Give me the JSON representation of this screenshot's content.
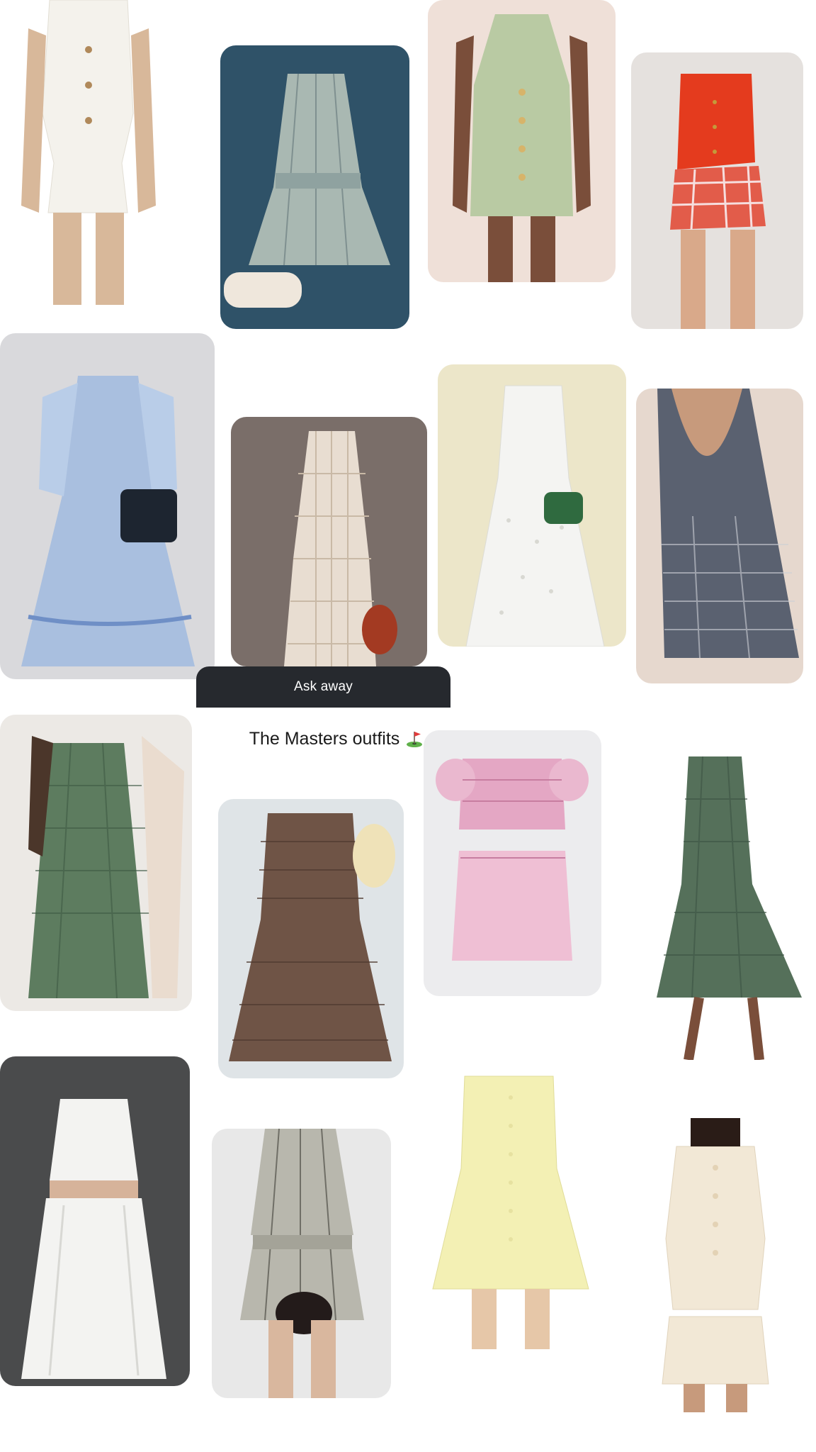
{
  "assistant": {
    "prompt_label": "Ask away"
  },
  "board": {
    "title": "The Masters outfits",
    "title_icon": "golf-flag-icon"
  },
  "pins": [
    {
      "id": "white-vest-mini-dress",
      "kind": "cutout",
      "bg": "#ffffff",
      "garment": "#f4f2ec"
    },
    {
      "id": "striped-shirt-dress",
      "kind": "photo",
      "bg": "#2f5268",
      "garment": "#a9b8b2"
    },
    {
      "id": "sage-halter-button-dress",
      "kind": "photo",
      "bg": "#efe0d8",
      "garment": "#b9caa3"
    },
    {
      "id": "red-vest-gingham-shorts",
      "kind": "photo",
      "bg": "#e5e1de",
      "garment": "#e43b1e"
    },
    {
      "id": "blue-embroidered-midi-dress",
      "kind": "photo",
      "bg": "#d9d9dc",
      "garment": "#a9bfdf"
    },
    {
      "id": "crochet-lace-midi-dress",
      "kind": "photo",
      "bg": "#7a6e69",
      "garment": "#e8ddd1"
    },
    {
      "id": "white-eyelet-strap-dress",
      "kind": "photo",
      "bg": "#ece6c9",
      "garment": "#f4f4f2"
    },
    {
      "id": "backless-gingham-mini-dress",
      "kind": "photo",
      "bg": "#e6d8ce",
      "garment": "#5a6170"
    },
    {
      "id": "green-gingham-button-dress",
      "kind": "photo",
      "bg": "#ece9e5",
      "garment": "#5d7c5f"
    },
    {
      "id": "brown-smocked-gingham-dress",
      "kind": "photo",
      "bg": "#dfe4e7",
      "garment": "#6f5446"
    },
    {
      "id": "pink-smocked-two-piece",
      "kind": "photo",
      "bg": "#ececee",
      "garment": "#e4a7c4"
    },
    {
      "id": "green-gingham-midi-dress",
      "kind": "photo",
      "bg": "#ffffff",
      "garment": "#55705a"
    },
    {
      "id": "white-top-and-midi-skirt",
      "kind": "photo",
      "bg": "#4a4b4c",
      "garment": "#f3f3f1"
    },
    {
      "id": "striped-shirt-and-shorts",
      "kind": "photo",
      "bg": "#e8e8e8",
      "garment": "#b8b7ad"
    },
    {
      "id": "yellow-button-mini-dress",
      "kind": "cutout",
      "bg": "#ffffff",
      "garment": "#f3f0b4"
    },
    {
      "id": "cream-vest-and-skirt",
      "kind": "cutout",
      "bg": "#ffffff",
      "garment": "#f2e8d6"
    }
  ]
}
